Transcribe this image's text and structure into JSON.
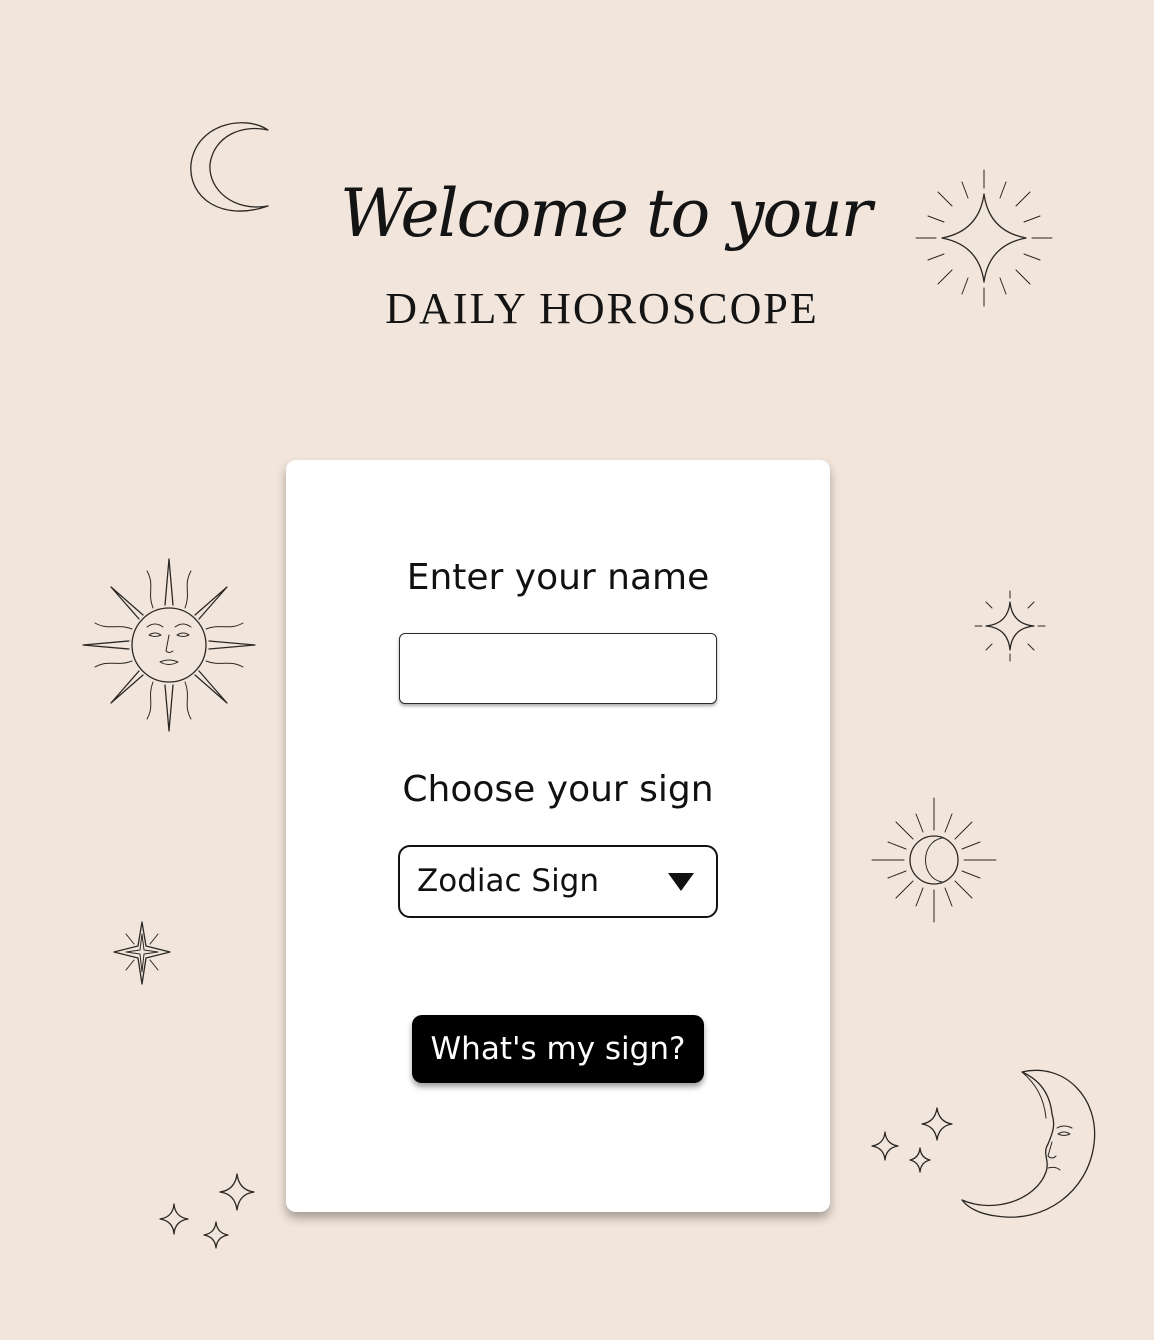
{
  "header": {
    "welcome": "Welcome to your",
    "title": "DAILY HOROSCOPE"
  },
  "form": {
    "name_label": "Enter your name",
    "name_value": "",
    "sign_label": "Choose your sign",
    "sign_selected": "Zodiac Sign",
    "submit_label": "What's my sign?"
  },
  "decorations": {
    "icons": [
      "crescent-moon-icon",
      "sparkle-star-icon",
      "sun-face-icon",
      "small-sparkle-icon",
      "radiant-moon-icon",
      "four-point-star-icon",
      "twinkle-stars-icon",
      "moon-face-icon"
    ]
  },
  "colors": {
    "background": "#f2e6dc",
    "card": "#ffffff",
    "button": "#000000",
    "button_text": "#ffffff",
    "ink": "#2b2724"
  }
}
